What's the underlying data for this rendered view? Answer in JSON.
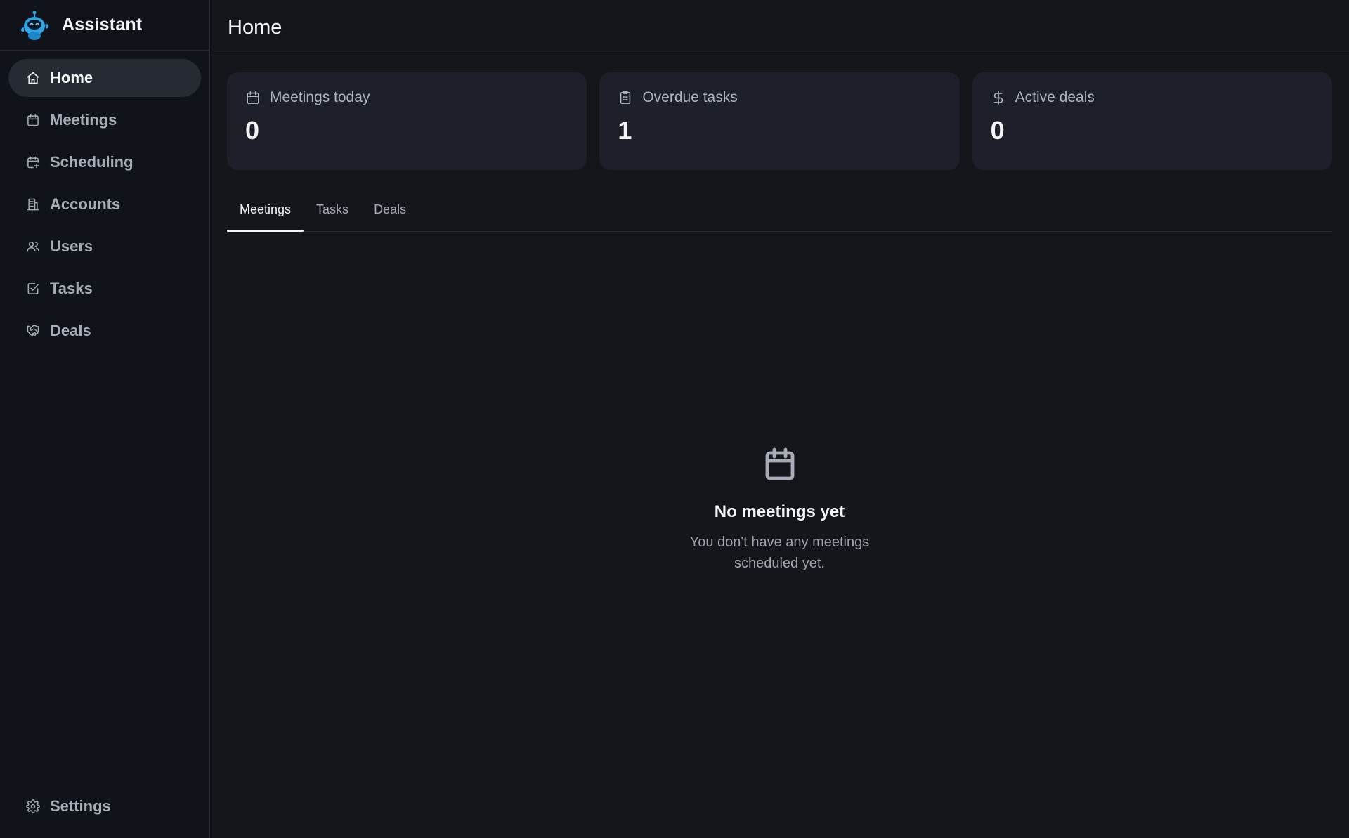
{
  "app": {
    "name": "Assistant",
    "logo_icon": "robot-mascot-icon",
    "accent_color": "#2fa4e7"
  },
  "sidebar": {
    "items": [
      {
        "label": "Home",
        "icon": "home-icon",
        "active": true
      },
      {
        "label": "Meetings",
        "icon": "calendar-icon"
      },
      {
        "label": "Scheduling",
        "icon": "calendar-plus-icon"
      },
      {
        "label": "Accounts",
        "icon": "building-icon"
      },
      {
        "label": "Users",
        "icon": "users-icon"
      },
      {
        "label": "Tasks",
        "icon": "checkbox-icon"
      },
      {
        "label": "Deals",
        "icon": "handshake-icon"
      }
    ],
    "settings": {
      "label": "Settings",
      "icon": "gear-icon"
    }
  },
  "header": {
    "title": "Home"
  },
  "stats": [
    {
      "label": "Meetings today",
      "value": "0",
      "icon": "calendar-icon"
    },
    {
      "label": "Overdue tasks",
      "value": "1",
      "icon": "clipboard-icon"
    },
    {
      "label": "Active deals",
      "value": "0",
      "icon": "dollar-icon"
    }
  ],
  "tabs": [
    {
      "label": "Meetings",
      "active": true
    },
    {
      "label": "Tasks"
    },
    {
      "label": "Deals"
    }
  ],
  "empty_state": {
    "icon": "calendar-icon",
    "title": "No meetings yet",
    "description": "You don't have any meetings scheduled yet."
  }
}
